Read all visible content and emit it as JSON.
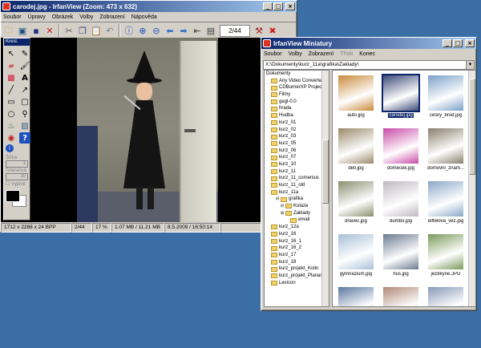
{
  "main_window": {
    "title": "carodej.jpg - IrfanView (Zoom: 473 x 632)",
    "menu": [
      "Soubor",
      "Úpravy",
      "Obrázek",
      "Volby",
      "Zobrazení",
      "Nápověda"
    ],
    "page_counter": "2/44",
    "status": {
      "dimensions": "1712 x 2288 x 24 BPP",
      "index": "2/44",
      "zoom": "17 %",
      "size": "1.07 MB / 11.21 MB",
      "date": "8.5.2009 / 16:50:14"
    }
  },
  "palette": {
    "title": "Kresl.",
    "width_label": "Šířka",
    "width_value": "1",
    "tolerance_label": "Tolerance",
    "tolerance_value": "30",
    "fill_label": "Vyplnit"
  },
  "thumbs_window": {
    "title": "IrfanView Miniatury",
    "menu": [
      "Soubor",
      "Volby",
      "Zobrazení",
      "Třídit",
      "Konec"
    ],
    "path": "X:\\Dokumenty\\kurz_11a\\grafika\\Zaklady\\",
    "tree": [
      {
        "label": "Dokumenty",
        "indent": 0,
        "folder": false
      },
      {
        "label": "Any Video Converter",
        "indent": 1,
        "folder": true
      },
      {
        "label": "CDBurnerXP Projects",
        "indent": 1,
        "folder": true
      },
      {
        "label": "Filmy",
        "indent": 1,
        "folder": true
      },
      {
        "label": "gegl-0.0",
        "indent": 1,
        "folder": true
      },
      {
        "label": "hrada",
        "indent": 1,
        "folder": true
      },
      {
        "label": "Hudba",
        "indent": 1,
        "folder": true
      },
      {
        "label": "kurz_01",
        "indent": 1,
        "folder": true
      },
      {
        "label": "kurz_02",
        "indent": 1,
        "folder": true
      },
      {
        "label": "kurz_03",
        "indent": 1,
        "folder": true
      },
      {
        "label": "kurz_05",
        "indent": 1,
        "folder": true
      },
      {
        "label": "kurz_06",
        "indent": 1,
        "folder": true
      },
      {
        "label": "kurz_07",
        "indent": 1,
        "folder": true
      },
      {
        "label": "kurz_10",
        "indent": 1,
        "folder": true
      },
      {
        "label": "kurz_11",
        "indent": 1,
        "folder": true
      },
      {
        "label": "kurz_11_comenius",
        "indent": 1,
        "folder": true
      },
      {
        "label": "kurz_11_old",
        "indent": 1,
        "folder": true
      },
      {
        "label": "kurz_11a",
        "indent": 1,
        "folder": true
      },
      {
        "label": "grafika",
        "indent": 2,
        "folder": true
      },
      {
        "label": "Kolaze",
        "indent": 3,
        "folder": true
      },
      {
        "label": "Zaklady",
        "indent": 3,
        "folder": true
      },
      {
        "label": "email",
        "indent": 4,
        "folder": true
      },
      {
        "label": "kurz_12a",
        "indent": 1,
        "folder": true
      },
      {
        "label": "kurz_16",
        "indent": 1,
        "folder": true
      },
      {
        "label": "kurz_16_1",
        "indent": 1,
        "folder": true
      },
      {
        "label": "kurz_16_2",
        "indent": 1,
        "folder": true
      },
      {
        "label": "kurz_17",
        "indent": 1,
        "folder": true
      },
      {
        "label": "kurz_18",
        "indent": 1,
        "folder": true
      },
      {
        "label": "kurz_projekt_Kolin",
        "indent": 1,
        "folder": true
      },
      {
        "label": "kurz_projekt_Planany",
        "indent": 1,
        "folder": true
      },
      {
        "label": "Lexicon",
        "indent": 1,
        "folder": true
      }
    ],
    "thumbnails": [
      {
        "name": "auto.jpg",
        "color": "#c98a3a",
        "selected": false
      },
      {
        "name": "carodej.jpg",
        "color": "#3d4a78",
        "selected": true
      },
      {
        "name": "cesky_brod.jpg",
        "color": "#7aa0c8",
        "selected": false
      },
      {
        "name": "deti.jpg",
        "color": "#9a8a6a",
        "selected": false
      },
      {
        "name": "domecek.jpg",
        "color": "#c84aa8",
        "selected": false
      },
      {
        "name": "domovni_znam...",
        "color": "#8a7e6e",
        "selected": false
      },
      {
        "name": "dravec.jpg",
        "color": "#8a9070",
        "selected": false
      },
      {
        "name": "dumbo.jpg",
        "color": "#c0b8c0",
        "selected": false
      },
      {
        "name": "eiffelova_vez.jpg",
        "color": "#8aa8c8",
        "selected": false
      },
      {
        "name": "gymnazium.jpg",
        "color": "#a8c0d8",
        "selected": false
      },
      {
        "name": "hus.jpg",
        "color": "#6a7a90",
        "selected": false
      },
      {
        "name": "jezdkyne.JPG",
        "color": "#7a9a5a",
        "selected": false
      },
      {
        "name": "",
        "color": "#5a78a0",
        "selected": false
      },
      {
        "name": "",
        "color": "#b08878",
        "selected": false
      },
      {
        "name": "",
        "color": "#8a9ab8",
        "selected": false
      }
    ]
  }
}
